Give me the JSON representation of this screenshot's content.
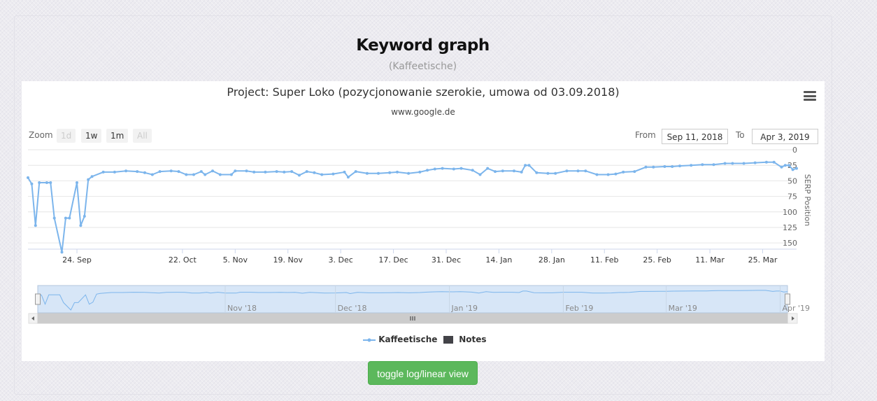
{
  "page": {
    "title": "Keyword graph",
    "subtitle": "(Kaffeetische)",
    "toggle_button": "toggle log/linear view"
  },
  "chart": {
    "title": "Project: Super Loko (pozycjonowanie szerokie, umowa od 03.09.2018)",
    "subtitle": "www.google.de",
    "zoom_label": "Zoom",
    "zoom_buttons": [
      "1d",
      "1w",
      "1m",
      "All"
    ],
    "from_label": "From",
    "from_value": "Sep 11, 2018",
    "to_label": "To",
    "to_value": "Apr 3, 2019",
    "legend": [
      "Kaffeetische",
      "Notes"
    ],
    "colors": {
      "series": "#7cb5ec",
      "notes": "#434348",
      "navigator_fill": "#d7e6f7",
      "button": "#5cb85c"
    }
  },
  "chart_data": {
    "type": "line",
    "ylabel": "SERP Position",
    "y_reversed": true,
    "ylim": [
      0,
      160
    ],
    "yticks": [
      0,
      25,
      50,
      75,
      100,
      125,
      150
    ],
    "xlim": [
      "2018-09-11",
      "2019-04-03"
    ],
    "xticks": [
      {
        "date": "2018-09-24",
        "label": "24. Sep"
      },
      {
        "date": "2018-10-22",
        "label": "22. Oct"
      },
      {
        "date": "2018-11-05",
        "label": "5. Nov"
      },
      {
        "date": "2018-11-19",
        "label": "19. Nov"
      },
      {
        "date": "2018-12-03",
        "label": "3. Dec"
      },
      {
        "date": "2018-12-17",
        "label": "17. Dec"
      },
      {
        "date": "2018-12-31",
        "label": "31. Dec"
      },
      {
        "date": "2019-01-14",
        "label": "14. Jan"
      },
      {
        "date": "2019-01-28",
        "label": "28. Jan"
      },
      {
        "date": "2019-02-11",
        "label": "11. Feb"
      },
      {
        "date": "2019-02-25",
        "label": "25. Feb"
      },
      {
        "date": "2019-03-11",
        "label": "11. Mar"
      },
      {
        "date": "2019-03-25",
        "label": "25. Mar"
      }
    ],
    "navigator_labels": [
      "Nov '18",
      "Dec '18",
      "Jan '19",
      "Feb '19",
      "Mar '19",
      "Apr '19"
    ],
    "series": [
      {
        "name": "Kaffeetische",
        "points": [
          [
            "2018-09-11",
            45
          ],
          [
            "2018-09-12",
            55
          ],
          [
            "2018-09-13",
            122
          ],
          [
            "2018-09-14",
            53
          ],
          [
            "2018-09-16",
            53
          ],
          [
            "2018-09-17",
            53
          ],
          [
            "2018-09-18",
            110
          ],
          [
            "2018-09-20",
            165
          ],
          [
            "2018-09-21",
            110
          ],
          [
            "2018-09-22",
            110
          ],
          [
            "2018-09-24",
            53
          ],
          [
            "2018-09-25",
            122
          ],
          [
            "2018-09-26",
            107
          ],
          [
            "2018-09-27",
            48
          ],
          [
            "2018-09-28",
            43
          ],
          [
            "2018-10-01",
            36
          ],
          [
            "2018-10-04",
            36
          ],
          [
            "2018-10-07",
            34
          ],
          [
            "2018-10-10",
            35
          ],
          [
            "2018-10-12",
            37
          ],
          [
            "2018-10-14",
            40
          ],
          [
            "2018-10-16",
            35
          ],
          [
            "2018-10-19",
            34
          ],
          [
            "2018-10-21",
            35
          ],
          [
            "2018-10-23",
            40
          ],
          [
            "2018-10-25",
            40
          ],
          [
            "2018-10-27",
            35
          ],
          [
            "2018-10-28",
            40
          ],
          [
            "2018-10-30",
            34
          ],
          [
            "2018-11-01",
            40
          ],
          [
            "2018-11-04",
            40
          ],
          [
            "2018-11-05",
            34
          ],
          [
            "2018-11-08",
            34
          ],
          [
            "2018-11-10",
            36
          ],
          [
            "2018-11-13",
            36
          ],
          [
            "2018-11-16",
            35
          ],
          [
            "2018-11-18",
            36
          ],
          [
            "2018-11-20",
            35
          ],
          [
            "2018-11-22",
            41
          ],
          [
            "2018-11-24",
            35
          ],
          [
            "2018-11-26",
            37
          ],
          [
            "2018-11-28",
            40
          ],
          [
            "2018-12-01",
            39
          ],
          [
            "2018-12-04",
            36
          ],
          [
            "2018-12-05",
            44
          ],
          [
            "2018-12-07",
            35
          ],
          [
            "2018-12-10",
            38
          ],
          [
            "2018-12-13",
            38
          ],
          [
            "2018-12-16",
            37
          ],
          [
            "2018-12-18",
            36
          ],
          [
            "2018-12-21",
            38
          ],
          [
            "2018-12-24",
            36
          ],
          [
            "2018-12-26",
            33
          ],
          [
            "2018-12-28",
            31
          ],
          [
            "2018-12-30",
            30
          ],
          [
            "2019-01-02",
            31
          ],
          [
            "2019-01-04",
            30
          ],
          [
            "2019-01-07",
            33
          ],
          [
            "2019-01-09",
            40
          ],
          [
            "2019-01-11",
            30
          ],
          [
            "2019-01-13",
            35
          ],
          [
            "2019-01-15",
            34
          ],
          [
            "2019-01-18",
            34
          ],
          [
            "2019-01-20",
            36
          ],
          [
            "2019-01-21",
            25
          ],
          [
            "2019-01-22",
            25
          ],
          [
            "2019-01-24",
            37
          ],
          [
            "2019-01-27",
            38
          ],
          [
            "2019-01-29",
            38
          ],
          [
            "2019-02-01",
            34
          ],
          [
            "2019-02-04",
            34
          ],
          [
            "2019-02-06",
            34
          ],
          [
            "2019-02-09",
            40
          ],
          [
            "2019-02-12",
            40
          ],
          [
            "2019-02-14",
            39
          ],
          [
            "2019-02-16",
            36
          ],
          [
            "2019-02-19",
            35
          ],
          [
            "2019-02-22",
            28
          ],
          [
            "2019-02-24",
            28
          ],
          [
            "2019-02-27",
            27
          ],
          [
            "2019-03-01",
            27
          ],
          [
            "2019-03-03",
            26
          ],
          [
            "2019-03-06",
            25
          ],
          [
            "2019-03-09",
            24
          ],
          [
            "2019-03-12",
            24
          ],
          [
            "2019-03-15",
            22
          ],
          [
            "2019-03-17",
            22
          ],
          [
            "2019-03-20",
            22
          ],
          [
            "2019-03-23",
            21
          ],
          [
            "2019-03-26",
            20
          ],
          [
            "2019-03-28",
            20
          ],
          [
            "2019-03-30",
            28
          ],
          [
            "2019-03-31",
            25
          ],
          [
            "2019-04-01",
            25
          ],
          [
            "2019-04-02",
            32
          ],
          [
            "2019-04-03",
            30
          ]
        ]
      }
    ]
  }
}
